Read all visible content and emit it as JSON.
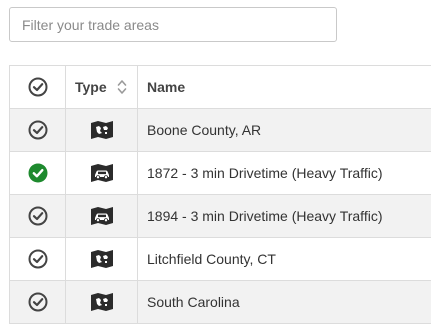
{
  "filter": {
    "placeholder": "Filter your trade areas",
    "value": ""
  },
  "table": {
    "headers": {
      "type": "Type",
      "name": "Name"
    },
    "rows": [
      {
        "selected": false,
        "type_icon": "map-icon",
        "name": "Boone County, AR"
      },
      {
        "selected": true,
        "type_icon": "car-icon",
        "name": "1872 - 3 min Drivetime (Heavy Traffic)"
      },
      {
        "selected": false,
        "type_icon": "car-icon",
        "name": "1894 - 3 min Drivetime (Heavy Traffic)"
      },
      {
        "selected": false,
        "type_icon": "map-icon",
        "name": "Litchfield County, CT"
      },
      {
        "selected": false,
        "type_icon": "map-icon",
        "name": "South Carolina"
      }
    ]
  },
  "colors": {
    "selected": "#1e8a2e",
    "unselected": "#444444",
    "icon": "#2b2b2b"
  }
}
